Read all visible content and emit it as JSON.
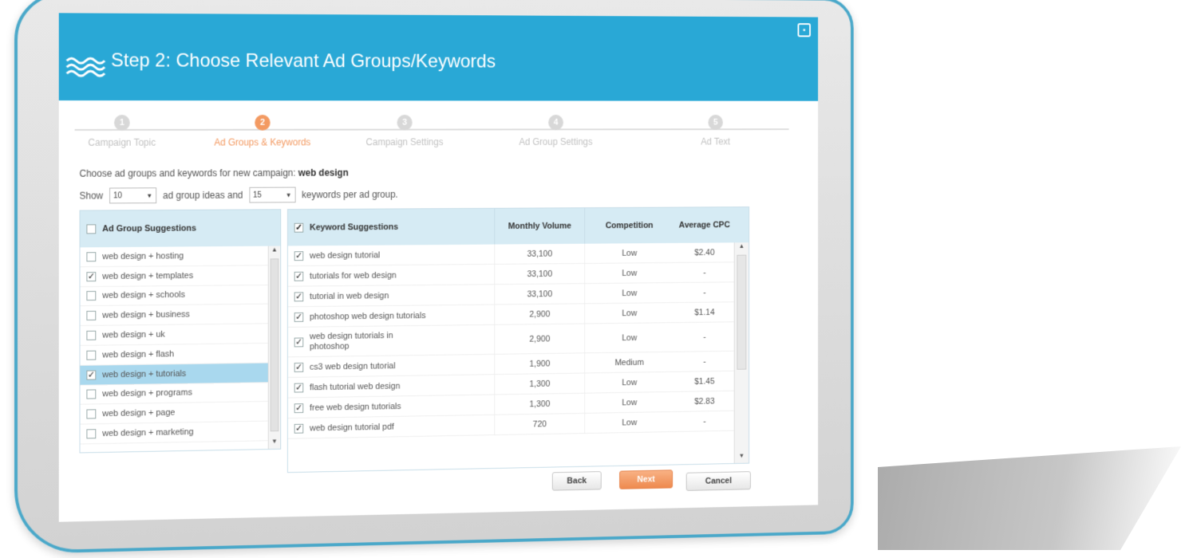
{
  "header": {
    "title": "Step 2: Choose Relevant Ad Groups/Keywords",
    "accent_color": "#29a8d6"
  },
  "steps": [
    {
      "number": "1",
      "label": "Campaign Topic",
      "active": false
    },
    {
      "number": "2",
      "label": "Ad Groups & Keywords",
      "active": true
    },
    {
      "number": "3",
      "label": "Campaign Settings",
      "active": false
    },
    {
      "number": "4",
      "label": "Ad Group Settings",
      "active": false
    },
    {
      "number": "5",
      "label": "Ad Text",
      "active": false
    }
  ],
  "intro": {
    "prefix": "Choose ad groups and keywords for new campaign:",
    "topic": "web design"
  },
  "show_row": {
    "show_label": "Show",
    "ad_group_count": "10",
    "middle_label": "ad group ideas and",
    "keyword_count": "15",
    "suffix": "keywords per ad group."
  },
  "ad_groups": {
    "header": "Ad Group Suggestions",
    "items": [
      {
        "label": "web design + hosting",
        "checked": false,
        "selected": false
      },
      {
        "label": "web design + templates",
        "checked": true,
        "selected": false
      },
      {
        "label": "web design + schools",
        "checked": false,
        "selected": false
      },
      {
        "label": "web design + business",
        "checked": false,
        "selected": false
      },
      {
        "label": "web design + uk",
        "checked": false,
        "selected": false
      },
      {
        "label": "web design + flash",
        "checked": false,
        "selected": false
      },
      {
        "label": "web design + tutorials",
        "checked": true,
        "selected": true
      },
      {
        "label": "web design + programs",
        "checked": false,
        "selected": false
      },
      {
        "label": "web design + page",
        "checked": false,
        "selected": false
      },
      {
        "label": "web design + marketing",
        "checked": false,
        "selected": false
      }
    ]
  },
  "keywords": {
    "headers": {
      "keyword": "Keyword Suggestions",
      "volume": "Monthly Volume",
      "competition": "Competition",
      "cpc": "Average CPC"
    },
    "rows": [
      {
        "keyword": "web design tutorial",
        "volume": "33,100",
        "competition": "Low",
        "cpc": "$2.40",
        "checked": true
      },
      {
        "keyword": "tutorials for web design",
        "volume": "33,100",
        "competition": "Low",
        "cpc": "-",
        "checked": true
      },
      {
        "keyword": "tutorial in web design",
        "volume": "33,100",
        "competition": "Low",
        "cpc": "-",
        "checked": true
      },
      {
        "keyword": "photoshop web design tutorials",
        "volume": "2,900",
        "competition": "Low",
        "cpc": "$1.14",
        "checked": true
      },
      {
        "keyword": "web design tutorials in photoshop",
        "volume": "2,900",
        "competition": "Low",
        "cpc": "-",
        "checked": true,
        "tall": true
      },
      {
        "keyword": "cs3 web design tutorial",
        "volume": "1,900",
        "competition": "Medium",
        "cpc": "-",
        "checked": true
      },
      {
        "keyword": "flash tutorial web design",
        "volume": "1,300",
        "competition": "Low",
        "cpc": "$1.45",
        "checked": true
      },
      {
        "keyword": "free web design tutorials",
        "volume": "1,300",
        "competition": "Low",
        "cpc": "$2.83",
        "checked": true
      },
      {
        "keyword": "web design tutorial pdf",
        "volume": "720",
        "competition": "Low",
        "cpc": "-",
        "checked": true
      }
    ]
  },
  "buttons": {
    "back": "Back",
    "next": "Next",
    "cancel": "Cancel"
  }
}
